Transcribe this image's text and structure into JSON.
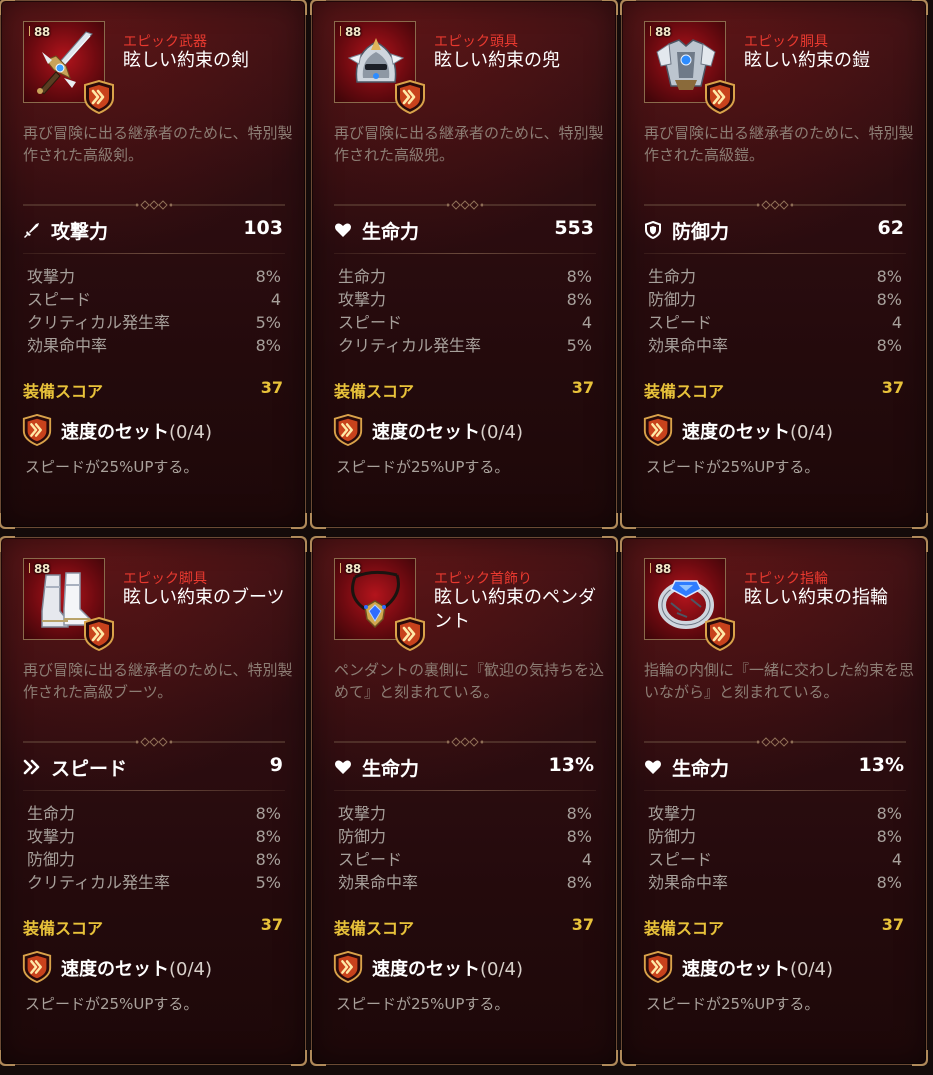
{
  "items": [
    {
      "level": "88",
      "rarity": "エピック武器",
      "name": "眩しい約束の剣",
      "art": "sword-icon",
      "description": "再び冒険に出る継承者のために、特別製作された高級剣。",
      "main_stat": {
        "icon": "sword-stat-icon",
        "name": "攻撃力",
        "value": "103"
      },
      "substats": [
        {
          "name": "攻撃力",
          "value": "8%"
        },
        {
          "name": "スピード",
          "value": "4"
        },
        {
          "name": "クリティカル発生率",
          "value": "5%"
        },
        {
          "name": "効果命中率",
          "value": "8%"
        }
      ],
      "score_label": "装備スコア",
      "score_value": "37",
      "set_name": "速度のセット",
      "set_count": "(0/4)",
      "set_desc": "スピードが25%UPする。"
    },
    {
      "level": "88",
      "rarity": "エピック頭具",
      "name": "眩しい約束の兜",
      "art": "helmet-icon",
      "description": "再び冒険に出る継承者のために、特別製作された高級兜。",
      "main_stat": {
        "icon": "heart-stat-icon",
        "name": "生命力",
        "value": "553"
      },
      "substats": [
        {
          "name": "生命力",
          "value": "8%"
        },
        {
          "name": "攻撃力",
          "value": "8%"
        },
        {
          "name": "スピード",
          "value": "4"
        },
        {
          "name": "クリティカル発生率",
          "value": "5%"
        }
      ],
      "score_label": "装備スコア",
      "score_value": "37",
      "set_name": "速度のセット",
      "set_count": "(0/4)",
      "set_desc": "スピードが25%UPする。"
    },
    {
      "level": "88",
      "rarity": "エピック胴具",
      "name": "眩しい約束の鎧",
      "art": "armor-icon",
      "description": "再び冒険に出る継承者のために、特別製作された高級鎧。",
      "main_stat": {
        "icon": "shield-stat-icon",
        "name": "防御力",
        "value": "62"
      },
      "substats": [
        {
          "name": "生命力",
          "value": "8%"
        },
        {
          "name": "防御力",
          "value": "8%"
        },
        {
          "name": "スピード",
          "value": "4"
        },
        {
          "name": "効果命中率",
          "value": "8%"
        }
      ],
      "score_label": "装備スコア",
      "score_value": "37",
      "set_name": "速度のセット",
      "set_count": "(0/4)",
      "set_desc": "スピードが25%UPする。"
    },
    {
      "level": "88",
      "rarity": "エピック脚具",
      "name": "眩しい約束のブーツ",
      "art": "boots-icon",
      "description": "再び冒険に出る継承者のために、特別製作された高級ブーツ。",
      "main_stat": {
        "icon": "speed-stat-icon",
        "name": "スピード",
        "value": "9"
      },
      "substats": [
        {
          "name": "生命力",
          "value": "8%"
        },
        {
          "name": "攻撃力",
          "value": "8%"
        },
        {
          "name": "防御力",
          "value": "8%"
        },
        {
          "name": "クリティカル発生率",
          "value": "5%"
        }
      ],
      "score_label": "装備スコア",
      "score_value": "37",
      "set_name": "速度のセット",
      "set_count": "(0/4)",
      "set_desc": "スピードが25%UPする。"
    },
    {
      "level": "88",
      "rarity": "エピック首飾り",
      "name": "眩しい約束のペンダント",
      "art": "necklace-icon",
      "description": "ペンダントの裏側に『歓迎の気持ちを込めて』と刻まれている。",
      "main_stat": {
        "icon": "heart-stat-icon",
        "name": "生命力",
        "value": "13%"
      },
      "substats": [
        {
          "name": "攻撃力",
          "value": "8%"
        },
        {
          "name": "防御力",
          "value": "8%"
        },
        {
          "name": "スピード",
          "value": "4"
        },
        {
          "name": "効果命中率",
          "value": "8%"
        }
      ],
      "score_label": "装備スコア",
      "score_value": "37",
      "set_name": "速度のセット",
      "set_count": "(0/4)",
      "set_desc": "スピードが25%UPする。"
    },
    {
      "level": "88",
      "rarity": "エピック指輪",
      "name": "眩しい約束の指輪",
      "art": "ring-icon",
      "description": "指輪の内側に『一緒に交わした約束を思いながら』と刻まれている。",
      "main_stat": {
        "icon": "heart-stat-icon",
        "name": "生命力",
        "value": "13%"
      },
      "substats": [
        {
          "name": "攻撃力",
          "value": "8%"
        },
        {
          "name": "防御力",
          "value": "8%"
        },
        {
          "name": "スピード",
          "value": "4"
        },
        {
          "name": "効果命中率",
          "value": "8%"
        }
      ],
      "score_label": "装備スコア",
      "score_value": "37",
      "set_name": "速度のセット",
      "set_count": "(0/4)",
      "set_desc": "スピードが25%UPする。"
    }
  ]
}
